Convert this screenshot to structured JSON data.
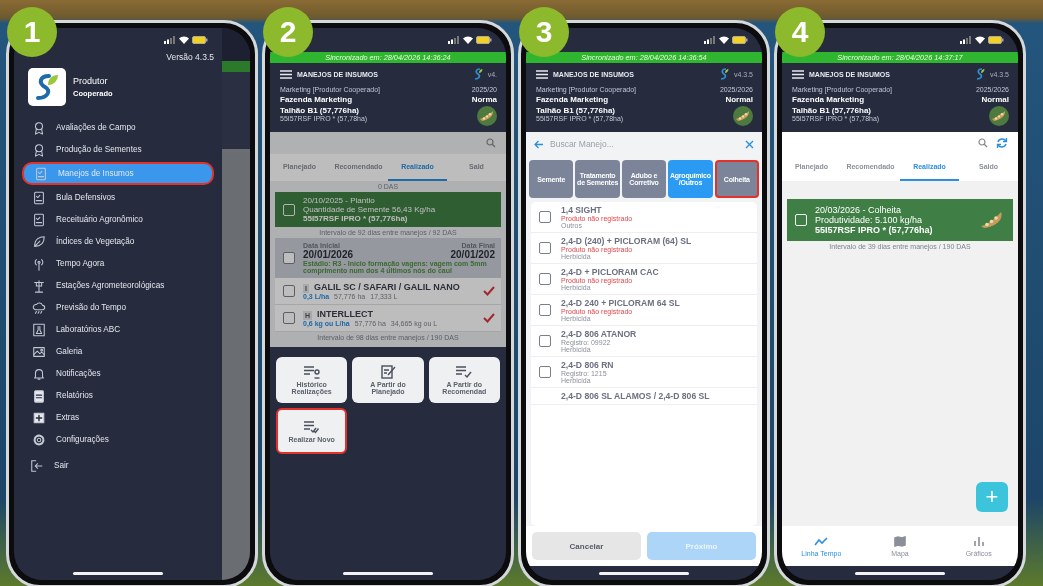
{
  "steps": [
    "1",
    "2",
    "3",
    "4"
  ],
  "drawer": {
    "version": "Versão 4.3.5",
    "profile_name": "Produtor",
    "profile_role": "Cooperado",
    "items": [
      {
        "label": "Avaliações de Campo",
        "selected": false,
        "highlighted": false
      },
      {
        "label": "Produção de Sementes",
        "selected": false,
        "highlighted": false
      },
      {
        "label": "Manejos de Insumos",
        "selected": true,
        "highlighted": true
      },
      {
        "label": "Bula Defensivos",
        "selected": false,
        "highlighted": false
      },
      {
        "label": "Receituário Agronômico",
        "selected": false,
        "highlighted": false
      },
      {
        "label": "Índices de Vegetação",
        "selected": false,
        "highlighted": false
      },
      {
        "label": "Tempo Agora",
        "selected": false,
        "highlighted": false
      },
      {
        "label": "Estações Agrometeorológicas",
        "selected": false,
        "highlighted": false
      },
      {
        "label": "Previsão do Tempo",
        "selected": false,
        "highlighted": false
      },
      {
        "label": "Laboratórios ABC",
        "selected": false,
        "highlighted": false
      },
      {
        "label": "Galeria",
        "selected": false,
        "highlighted": false
      },
      {
        "label": "Notificações",
        "selected": false,
        "highlighted": false
      },
      {
        "label": "Relatórios",
        "selected": false,
        "highlighted": false
      },
      {
        "label": "Extras",
        "selected": false,
        "highlighted": false
      },
      {
        "label": "Configurações",
        "selected": false,
        "highlighted": false
      }
    ],
    "logout": "Sair"
  },
  "screen_2": {
    "header": {
      "sync": "Sincronizado em: 28/04/2026 14:36:24",
      "title": "MANEJOS DE INSUMOS",
      "version": "v4.",
      "account": "Marketing [Produtor Cooperado]",
      "farm": "Fazenda Marketing",
      "season": "2025/20",
      "season_type": "Norma",
      "field": "Talhão B1 (57,776ha)",
      "variety": "55I57RSF IPRO * (57,78ha)"
    },
    "tabs": [
      {
        "label": "Planejado",
        "selected": false
      },
      {
        "label": "Recomendado",
        "selected": false
      },
      {
        "label": "Realizado",
        "selected": true
      },
      {
        "label": "Sald",
        "selected": false
      }
    ],
    "timeline": [
      {
        "kind": "das",
        "text": "0 DAS"
      },
      {
        "kind": "event",
        "checked": false,
        "title": "20/10/2025 - Plantio",
        "detail": "Quantidade de Semente 56,43 Kg/ha",
        "variety": "55I57RSF IPRO * (57,776ha)"
      },
      {
        "kind": "interval",
        "text": "Intervalo de 92 dias entre manejos / 92 DAS"
      },
      {
        "kind": "stage",
        "checked": false,
        "start_label": "Data Inicial",
        "start": "20/01/2026",
        "end_label": "Data Final",
        "end": "20/01/202",
        "stage": "Estádio: R3 - Início formação vagens: vagem com 5mm comprimento num dos 4 últimos nós do caul"
      },
      {
        "kind": "product",
        "checked": false,
        "tag": "I",
        "name": "GALIL SC / SAFARI / GALIL NANO",
        "rate": "0,3 L/ha",
        "area": "57,776 ha",
        "total": "17,333 L",
        "done": true
      },
      {
        "kind": "product",
        "checked": false,
        "tag": "H",
        "name": "INTERLLECT",
        "rate": "0,6 kg ou L/ha",
        "area": "57,776 ha",
        "total": "34,665 kg ou L",
        "done": true
      },
      {
        "kind": "interval",
        "text": "Intervalo de 98 dias entre manejos / 190 DAS"
      }
    ],
    "actions": [
      {
        "label": "Histórico Realizações",
        "highlighted": false
      },
      {
        "label": "A Partir do Planejado",
        "highlighted": false
      },
      {
        "label": "A Partir do Recomendad",
        "highlighted": false
      },
      {
        "label": "Realizar Novo",
        "highlighted": true
      }
    ]
  },
  "screen_3": {
    "header": {
      "sync": "Sincronizado em: 28/04/2026 14:36:54",
      "title": "MANEJOS DE INSUMOS",
      "version": "v4.3.5",
      "account": "Marketing [Produtor Cooperado]",
      "farm": "Fazenda Marketing",
      "season": "2025/2026",
      "season_type": "Normal",
      "field": "Talhão B1 (57,776ha)",
      "variety": "55I57RSF IPRO * (57,78ha)"
    },
    "search": {
      "placeholder": "Buscar Manejo..."
    },
    "categories": [
      {
        "label": "Semente",
        "selected": false,
        "highlighted": false
      },
      {
        "label": "Tratamento de Sementes",
        "selected": false,
        "highlighted": false
      },
      {
        "label": "Adubo e Corretivo",
        "selected": false,
        "highlighted": false
      },
      {
        "label": "Agroquímico /Outros",
        "selected": true,
        "highlighted": false
      },
      {
        "label": "Colheita",
        "selected": false,
        "highlighted": true
      }
    ],
    "products": [
      {
        "name": "1,4 SIGHT",
        "note": "Produto não registrado",
        "warning": true,
        "category": "Outros",
        "checked": false
      },
      {
        "name": "2,4-D (240) + PICLORAM (64) SL",
        "note": "Produto não registrado",
        "warning": true,
        "category": "Herbicida",
        "checked": false
      },
      {
        "name": "2,4-D + PICLORAM CAC",
        "note": "Produto não registrado",
        "warning": true,
        "category": "Herbicida",
        "checked": false
      },
      {
        "name": "2,4-D 240 + PICLORAM 64 SL",
        "note": "Produto não registrado",
        "warning": true,
        "category": "Herbicida",
        "checked": false
      },
      {
        "name": "2,4-D 806 ATANOR",
        "note": "Registro: 09922",
        "warning": false,
        "category": "Herbicida",
        "checked": false
      },
      {
        "name": "2,4-D 806 RN",
        "note": "Registro: 1215",
        "warning": false,
        "category": "Herbicida",
        "checked": false
      },
      {
        "name": "2,4-D 806 SL ALAMOS / 2,4-D 806 SL"
      }
    ],
    "cancel": "Cancelar",
    "next": {
      "label": "Próximo",
      "disabled": true
    }
  },
  "screen_4": {
    "header": {
      "sync": "Sincronizado em: 28/04/2026 14:37:17",
      "title": "MANEJOS DE INSUMOS",
      "version": "v4.3.5",
      "account": "Marketing [Produtor Cooperado]",
      "farm": "Fazenda Marketing",
      "season": "2025/2026",
      "season_type": "Normal",
      "field": "Talhão B1 (57,776ha)",
      "variety": "55I57RSF IPRO * (57,78ha)"
    },
    "tabs": [
      {
        "label": "Planejado",
        "selected": false
      },
      {
        "label": "Recomendado",
        "selected": false
      },
      {
        "label": "Realizado",
        "selected": true
      },
      {
        "label": "Saldo",
        "selected": false
      }
    ],
    "event": {
      "checked": false,
      "title": "20/03/2026 - Colheita",
      "detail": "Produtividade: 5.100 kg/ha",
      "variety": "55I57RSF IPRO * (57,776ha)"
    },
    "interval": "Intervalo de 39 dias entre manejos / 190 DAS",
    "fab": "+",
    "nav": [
      {
        "label": "Linha Tempo",
        "selected": true
      },
      {
        "label": "Mapa",
        "selected": false
      },
      {
        "label": "Gráficos",
        "selected": false
      }
    ]
  }
}
